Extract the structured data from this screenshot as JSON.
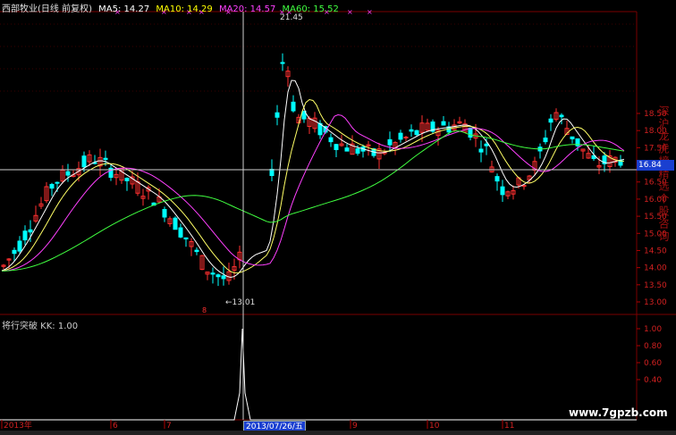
{
  "header": {
    "stock_label": "西部牧业(日线 前复权)",
    "ma5": "MA5: 14.27",
    "ma10": "MA10: 14.29",
    "ma20": "MA20: 14.57",
    "ma60": "MA60: 15.52",
    "colors": {
      "stock": "#e0e0e0",
      "ma5": "#ffffff",
      "ma10": "#ffff00",
      "ma20": "#ff40ff",
      "ma60": "#40ff40"
    }
  },
  "price_axis": {
    "ticks": [
      "18.50",
      "18.00",
      "17.50",
      "17.00",
      "16.50",
      "16.00",
      "15.50",
      "15.00",
      "14.50",
      "14.00",
      "13.50",
      "13.00"
    ]
  },
  "current_price": "16.84",
  "annotations": {
    "high": "21.45",
    "low": "←13.01"
  },
  "indicator": {
    "title": "将行突破  KK: 1.00",
    "ticks": [
      "1.00",
      "0.80",
      "0.60",
      "0.40"
    ]
  },
  "time_axis": {
    "labels": [
      "2013年",
      "6",
      "7",
      "9",
      "10",
      "11"
    ],
    "selected_date": "2013/07/26/五"
  },
  "vertical_side_text": "深沪龙虎榜精选个股咨询",
  "watermark": "www.7gpzb.com"
}
